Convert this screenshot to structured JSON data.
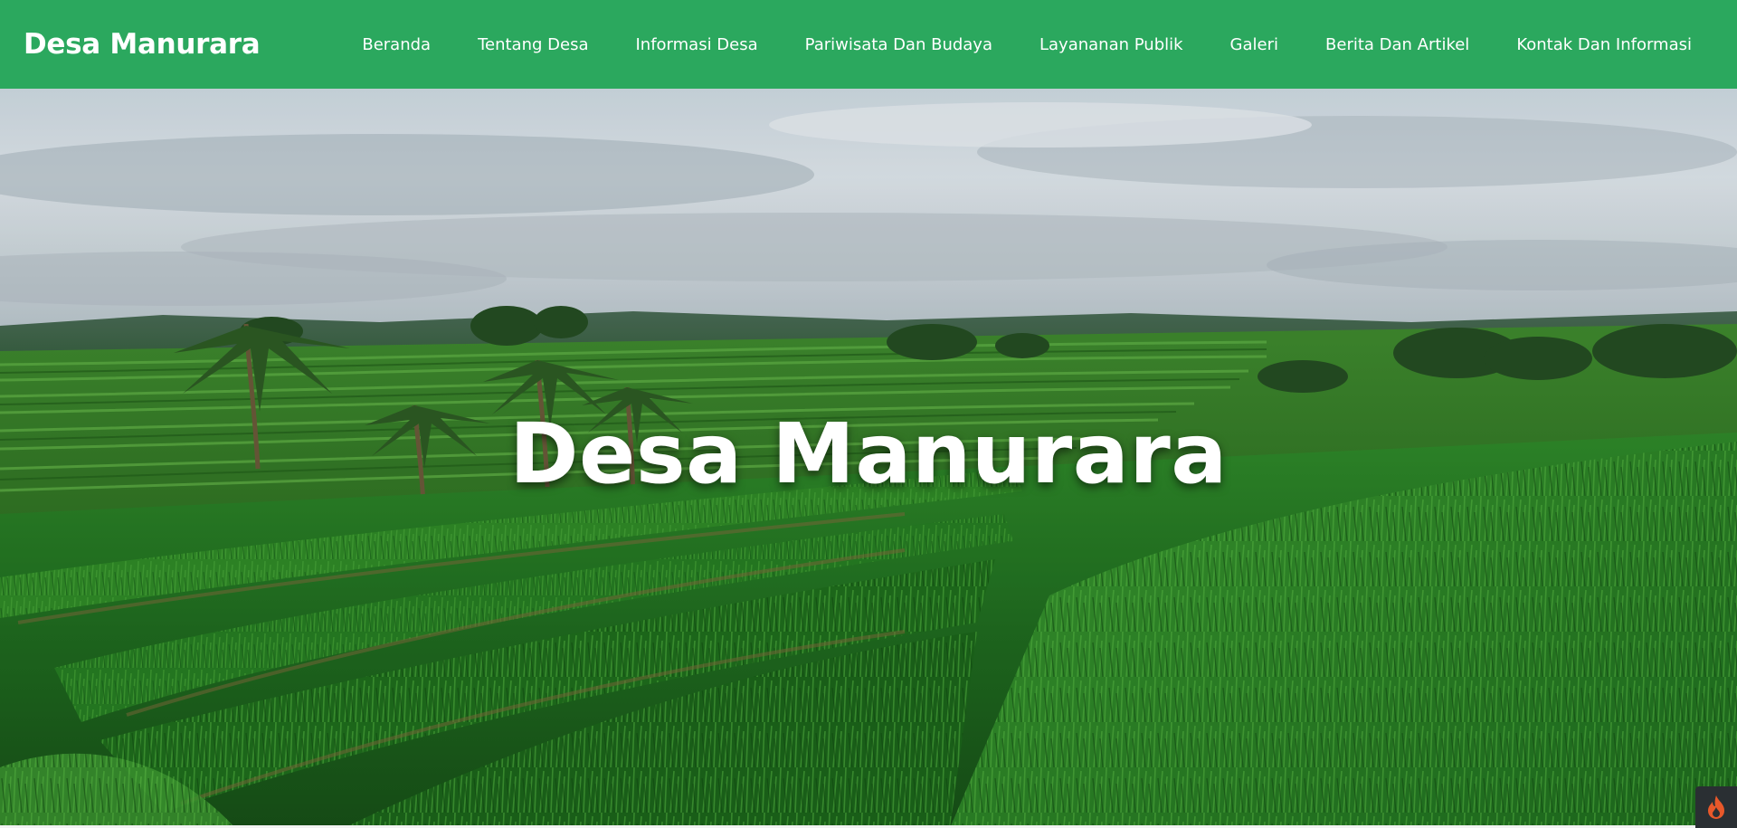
{
  "header": {
    "brand": "Desa Manurara",
    "nav": [
      {
        "label": "Beranda"
      },
      {
        "label": "Tentang Desa"
      },
      {
        "label": "Informasi Desa"
      },
      {
        "label": "Pariwisata Dan Budaya"
      },
      {
        "label": "Layananan Publik"
      },
      {
        "label": "Galeri"
      },
      {
        "label": "Berita Dan Artikel"
      },
      {
        "label": "Kontak Dan Informasi"
      }
    ]
  },
  "hero": {
    "title": "Desa Manurara",
    "background": "rice-terrace-landscape"
  },
  "corner_badge": {
    "icon": "flame-icon"
  },
  "colors": {
    "nav_background": "#2ba85e",
    "text": "#ffffff"
  }
}
